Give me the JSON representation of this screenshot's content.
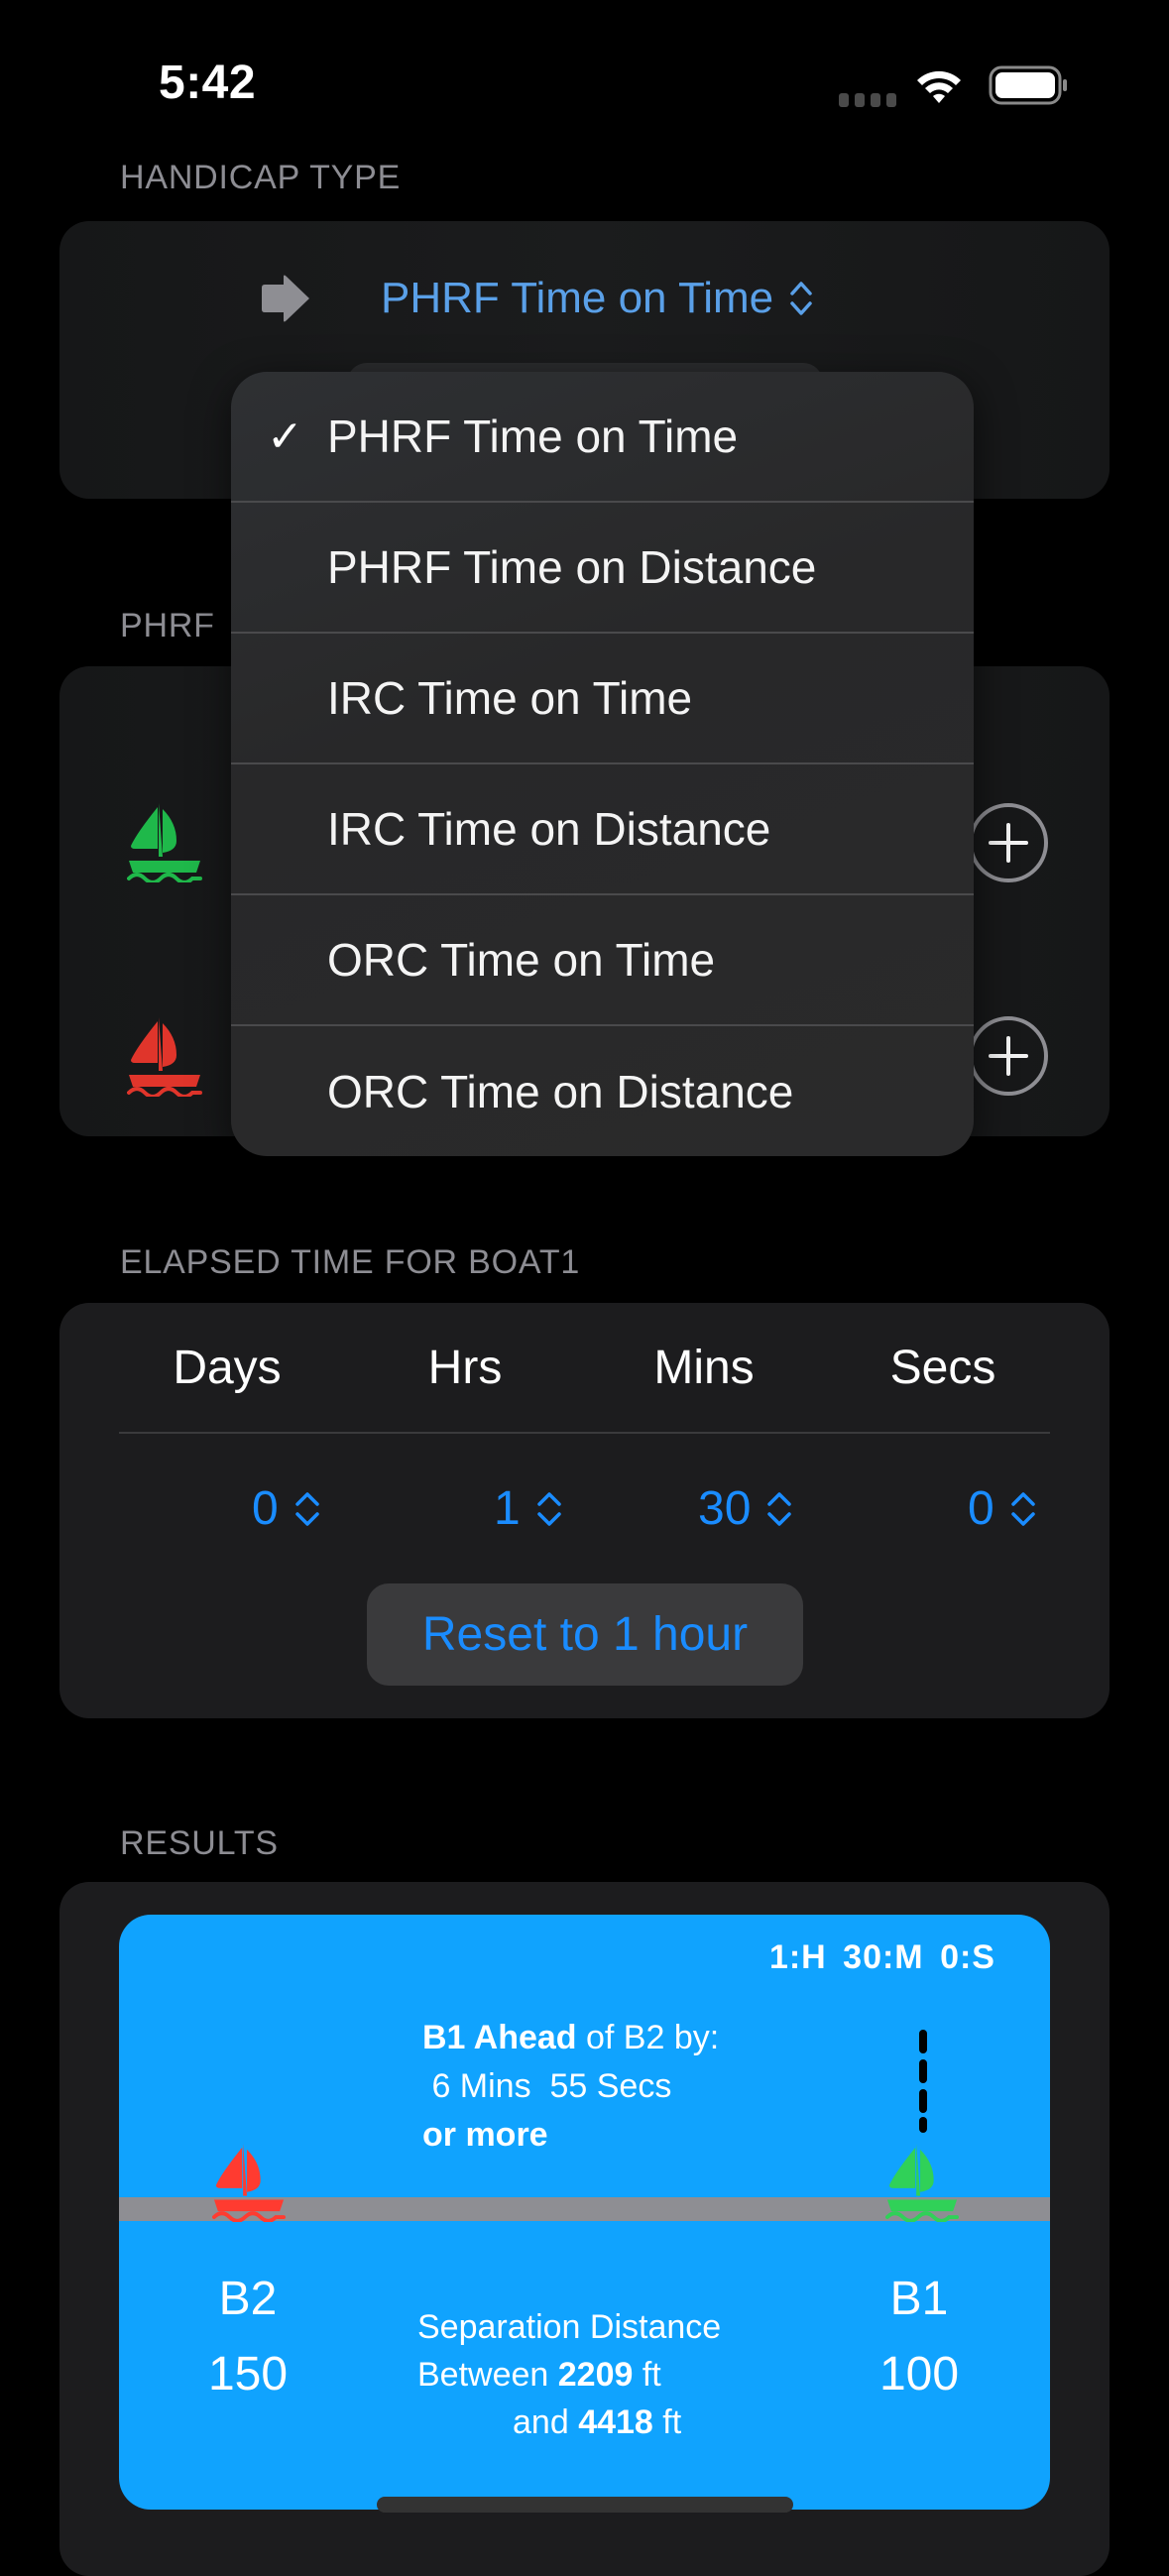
{
  "status_bar": {
    "time": "5:42",
    "icons": [
      "cellular-signal-icon",
      "wifi-icon",
      "battery-icon"
    ]
  },
  "handicap_type": {
    "header": "HANDICAP TYPE",
    "selected": "PHRF Time on Time",
    "leading_icon": "arrow-right-icon",
    "trailing_icon": "chevron-up-down-icon",
    "accent_color": "#5aa0e8"
  },
  "dropdown_menu": {
    "check_glyph": "✓",
    "items": [
      {
        "label": "PHRF Time on Time",
        "checked": true
      },
      {
        "label": "PHRF Time on Distance",
        "checked": false
      },
      {
        "label": "IRC Time on Time",
        "checked": false
      },
      {
        "label": "IRC Time on Distance",
        "checked": false
      },
      {
        "label": "ORC Time on Time",
        "checked": false
      },
      {
        "label": "ORC Time on Distance",
        "checked": false
      }
    ]
  },
  "phrf_section": {
    "header": "PHRF",
    "boats": [
      {
        "id": "B1",
        "color": "#1fb84a",
        "icon": "sailboat-icon",
        "action_icon": "plus-circle-icon"
      },
      {
        "id": "B2",
        "color": "#e0352b",
        "icon": "sailboat-icon",
        "action_icon": "plus-circle-icon"
      }
    ]
  },
  "elapsed_time": {
    "header": "ELAPSED TIME FOR BOAT1",
    "columns": [
      {
        "label": "Days",
        "value": "0"
      },
      {
        "label": "Hrs",
        "value": "1"
      },
      {
        "label": "Mins",
        "value": "30"
      },
      {
        "label": "Secs",
        "value": "0"
      }
    ],
    "reset_label": "Reset to 1 hour",
    "accent_color": "#1a8cff"
  },
  "results": {
    "header": "RESULTS",
    "panel_color": "#10a3fe",
    "time_summary": "1:H  30:M  0:S",
    "ahead_bold": "B1 Ahead",
    "ahead_rest": " of B2 by:",
    "gap_text": " 6 Mins  55 Secs",
    "gap_qualifier": "or more",
    "separation_title": "Separation Distance",
    "between_prefix": "Between ",
    "between_min": "2209",
    "between_unit1": " ft",
    "and_prefix": "and ",
    "between_max": "4418",
    "between_unit2": " ft",
    "boats": [
      {
        "name": "B2",
        "rating": "150",
        "color": "#ff3b30"
      },
      {
        "name": "B1",
        "rating": "100",
        "color": "#30d158"
      }
    ]
  }
}
